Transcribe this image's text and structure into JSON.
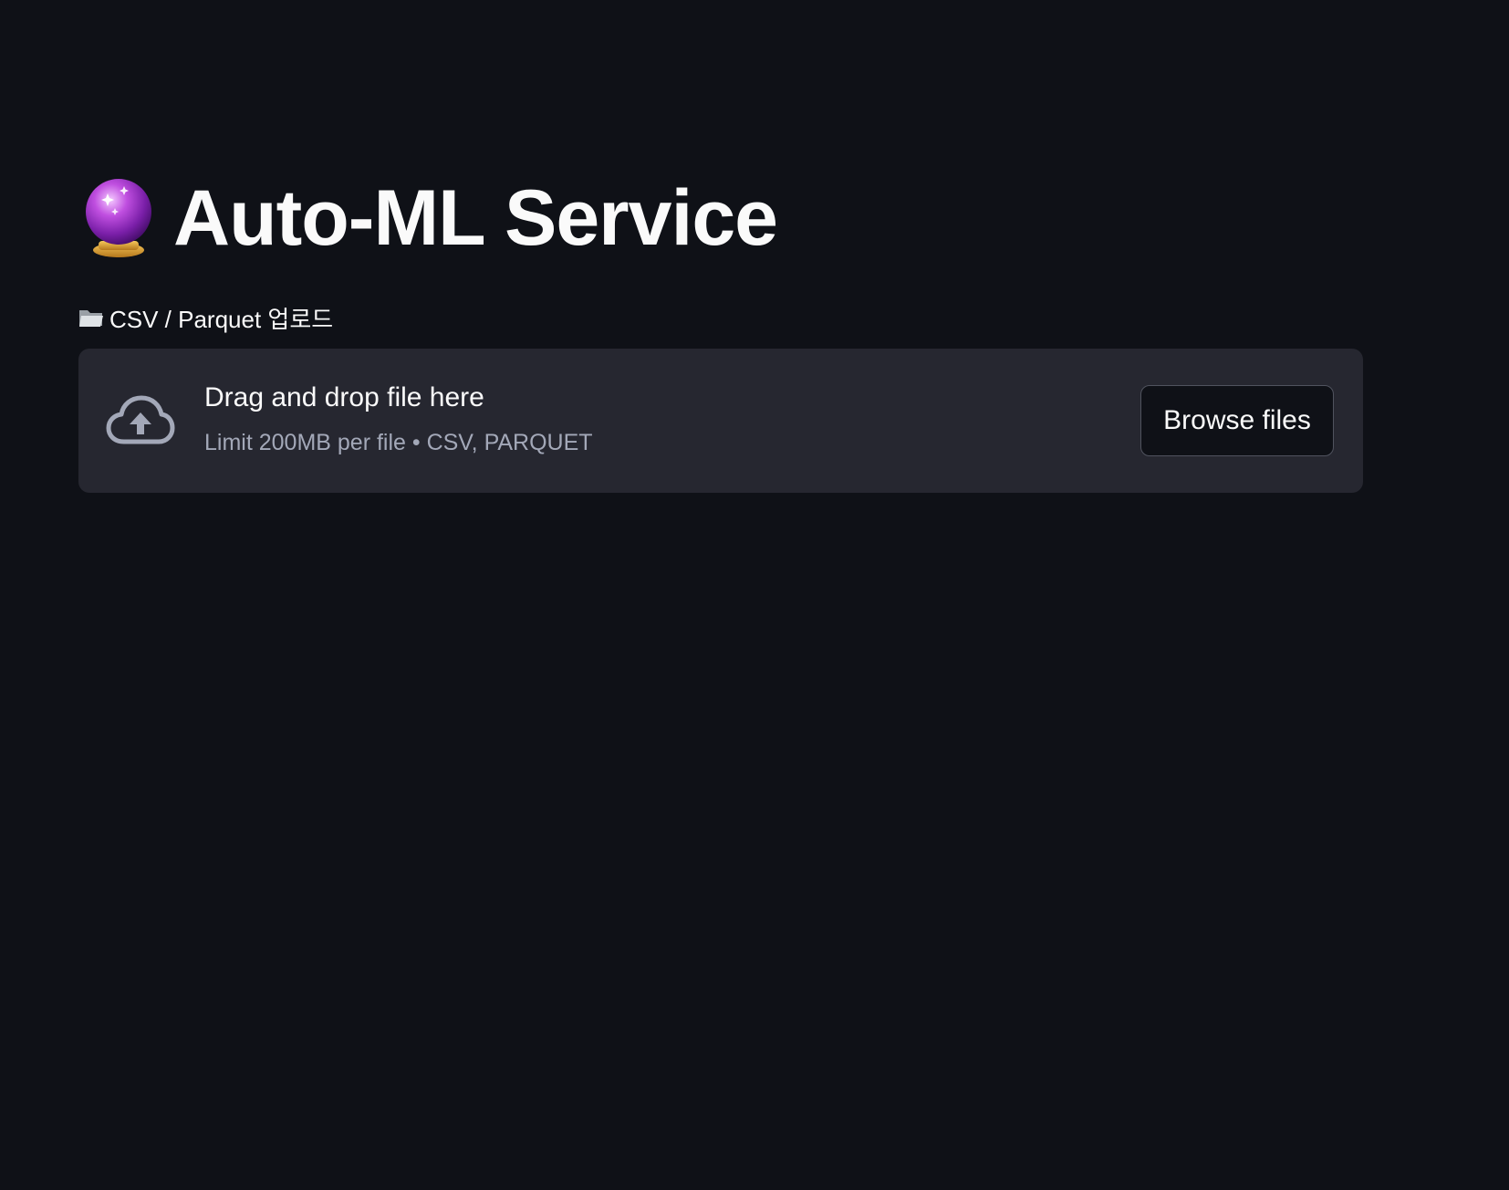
{
  "header": {
    "title": "Auto-ML Service",
    "title_icon": "crystal-ball-icon"
  },
  "uploader": {
    "label": "CSV / Parquet 업로드",
    "label_icon": "open-folder-icon",
    "upload_icon": "cloud-upload-icon",
    "drag_text": "Drag and drop file here",
    "limit_text": "Limit 200MB per file • CSV, PARQUET",
    "browse_label": "Browse files"
  },
  "colors": {
    "background": "#0f1117",
    "dropzone": "#262730",
    "text": "#fafafa",
    "muted_text": "#a3a8b8"
  }
}
